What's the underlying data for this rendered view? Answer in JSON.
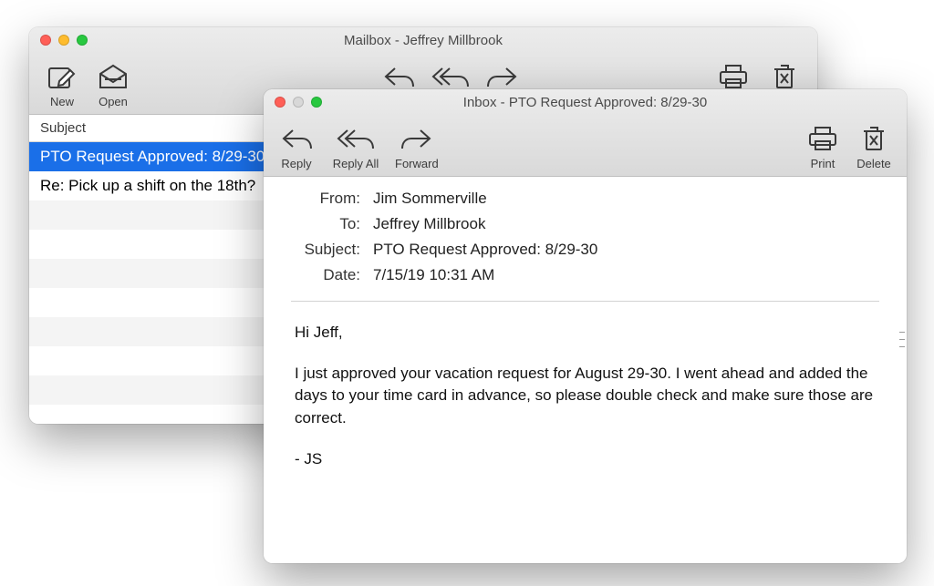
{
  "mailbox": {
    "title": "Mailbox - Jeffrey Millbrook",
    "toolbar": {
      "new": "New",
      "open": "Open",
      "reply": "Reply",
      "reply_all": "Reply All",
      "forward": "Forward",
      "print": "Print",
      "delete": "Delete"
    },
    "list_header": "Subject",
    "rows": [
      {
        "subject": "PTO Request Approved: 8/29-30",
        "selected": true
      },
      {
        "subject": "Re: Pick up a shift on the 18th?",
        "selected": false
      }
    ]
  },
  "message": {
    "title": "Inbox - PTO Request Approved: 8/29-30",
    "toolbar": {
      "reply": "Reply",
      "reply_all": "Reply All",
      "forward": "Forward",
      "print": "Print",
      "delete": "Delete"
    },
    "headers": {
      "from_label": "From:",
      "from": "Jim Sommerville",
      "to_label": "To:",
      "to": "Jeffrey Millbrook",
      "subject_label": "Subject:",
      "subject": "PTO Request Approved: 8/29-30",
      "date_label": "Date:",
      "date": "7/15/19 10:31 AM"
    },
    "body": {
      "greeting": "Hi Jeff,",
      "para1": "I just approved your vacation request for August 29-30. I went ahead and added the days to your time card in advance, so please double check and make sure those are correct.",
      "signoff": "- JS"
    }
  }
}
